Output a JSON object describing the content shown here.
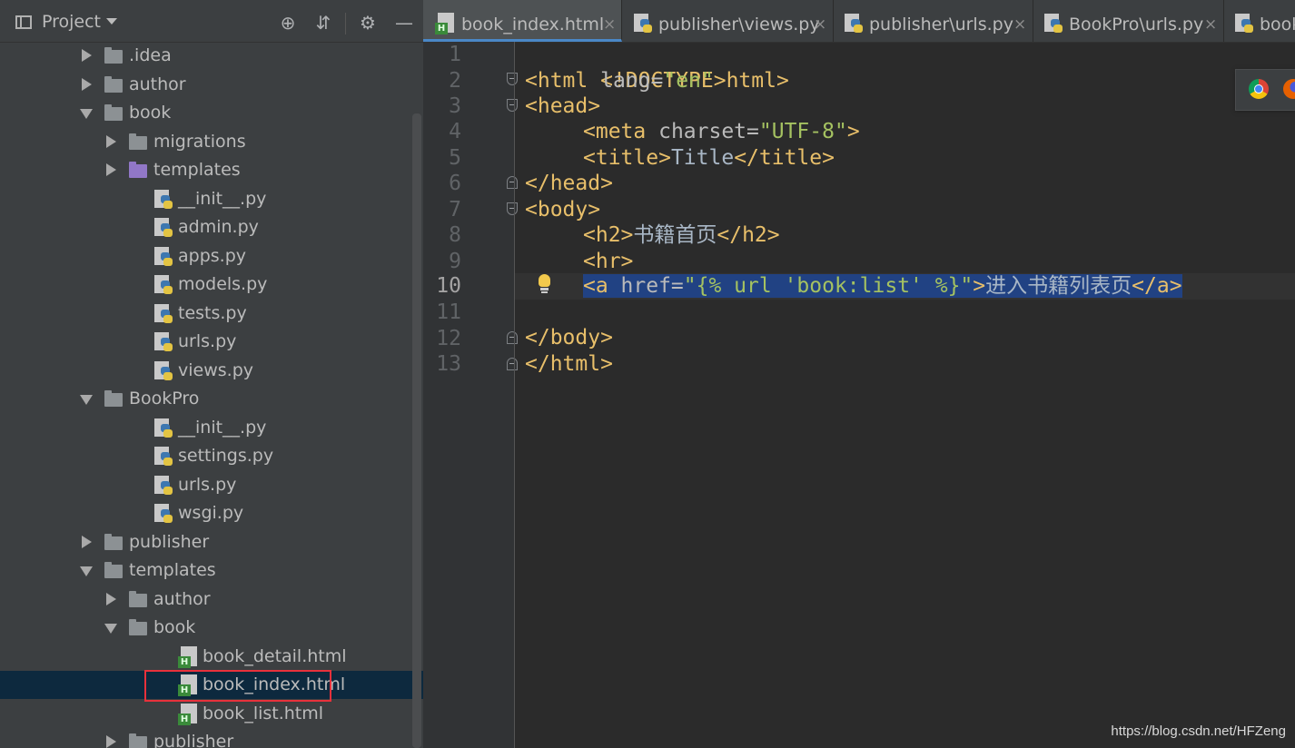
{
  "project_panel": {
    "title": "Project",
    "icons": [
      "locate-icon",
      "collapse-all-icon",
      "gear-icon",
      "minimize-icon"
    ],
    "tree": [
      {
        "label": ".idea",
        "type": "folder",
        "expanded": false
      },
      {
        "label": "author",
        "type": "folder",
        "expanded": false
      },
      {
        "label": "book",
        "type": "folder",
        "expanded": true
      },
      {
        "label": "migrations",
        "type": "folder",
        "expanded": false
      },
      {
        "label": "templates",
        "type": "folder-purple",
        "expanded": false
      },
      {
        "label": "__init__.py",
        "type": "python"
      },
      {
        "label": "admin.py",
        "type": "python"
      },
      {
        "label": "apps.py",
        "type": "python"
      },
      {
        "label": "models.py",
        "type": "python"
      },
      {
        "label": "tests.py",
        "type": "python"
      },
      {
        "label": "urls.py",
        "type": "python"
      },
      {
        "label": "views.py",
        "type": "python"
      },
      {
        "label": "BookPro",
        "type": "folder",
        "expanded": true
      },
      {
        "label": "__init__.py",
        "type": "python"
      },
      {
        "label": "settings.py",
        "type": "python"
      },
      {
        "label": "urls.py",
        "type": "python"
      },
      {
        "label": "wsgi.py",
        "type": "python"
      },
      {
        "label": "publisher",
        "type": "folder",
        "expanded": false
      },
      {
        "label": "templates",
        "type": "folder",
        "expanded": true
      },
      {
        "label": "author",
        "type": "folder",
        "expanded": false
      },
      {
        "label": "book",
        "type": "folder",
        "expanded": true
      },
      {
        "label": "book_detail.html",
        "type": "html"
      },
      {
        "label": "book_index.html",
        "type": "html",
        "selected": true
      },
      {
        "label": "book_list.html",
        "type": "html"
      },
      {
        "label": "publisher",
        "type": "folder",
        "expanded": false
      }
    ]
  },
  "tabs": [
    {
      "label": "book_index.html",
      "active": true,
      "close": "×"
    },
    {
      "label": "publisher\\views.py",
      "close": "×"
    },
    {
      "label": "publisher\\urls.py",
      "close": "×"
    },
    {
      "label": "BookPro\\urls.py",
      "close": "×"
    },
    {
      "label": "book",
      "close": ""
    }
  ],
  "editor": {
    "line_numbers": [
      "1",
      "2",
      "3",
      "4",
      "5",
      "6",
      "7",
      "8",
      "9",
      "10",
      "11",
      "12",
      "13"
    ],
    "current_line": "10",
    "lines": {
      "l1": "<!DOCTYPE html>",
      "l2_tag_open": "<html ",
      "l2_attr": "lang=",
      "l2_str": "\"en\"",
      "l2_tag_close": ">",
      "l3": "<head>",
      "l4_tag_open": "<meta ",
      "l4_attr": "charset=",
      "l4_str": "\"UTF-8\"",
      "l4_tag_close": ">",
      "l5_tag_open": "<title>",
      "l5_text": "Title",
      "l5_tag_close": "</title>",
      "l6": "</head>",
      "l7": "<body>",
      "l8_tag_open": "<h2>",
      "l8_text": "书籍首页",
      "l8_tag_close": "</h2>",
      "l9": "<hr>",
      "l10_tag_open": "<a ",
      "l10_attr": "href=",
      "l10_str": "\"{% url 'book:list' %}\"",
      "l10_gt": ">",
      "l10_text": "进入书籍列表页",
      "l10_tag_close": "</a>",
      "l12": "</body>",
      "l13": "</html>"
    }
  },
  "watermark": "https://blog.csdn.net/HFZeng",
  "colors": {
    "tag": "#e8bf6a",
    "string": "#a5c261",
    "selection": "#214283",
    "panel_bg": "#3c3f41",
    "editor_bg": "#2b2b2b",
    "highlight_box": "#e8313b"
  }
}
